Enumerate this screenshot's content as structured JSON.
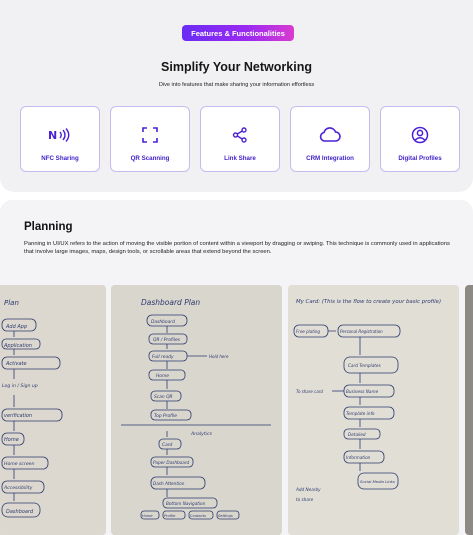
{
  "features": {
    "badge": "Features & Functionalities",
    "title": "Simplify Your Networking",
    "subtitle": "Dive into features that make sharing your information effortless",
    "accent_color": "#4b21d6",
    "cards": [
      {
        "label": "NFC Sharing",
        "icon": "nfc-icon"
      },
      {
        "label": "QR Scanning",
        "icon": "qr-scan-icon"
      },
      {
        "label": "Link Share",
        "icon": "share-icon"
      },
      {
        "label": "CRM Integration",
        "icon": "cloud-icon"
      },
      {
        "label": "Digital Profiles",
        "icon": "profile-icon"
      }
    ]
  },
  "planning": {
    "title": "Planning",
    "description": "Panning in UI/UX refers to the action of moving the visible portion of content within a viewport by dragging or swiping. This technique is commonly used in applications that involve large images, maps, design tools, or scrollable areas that extend beyond the screen.",
    "sketches": [
      {
        "name": "sketch-1",
        "lines": [
          "Plan",
          "Add App",
          "Application",
          "Activate",
          "Log in / Sign up",
          "verification",
          "Home",
          "Home screen",
          "Accessibility",
          "Dashboard"
        ]
      },
      {
        "name": "sketch-2",
        "heading": "Dashboard Plan",
        "lines": [
          "Dashboard",
          "QR / Profiles",
          "Full ready",
          "Hold here",
          "Home",
          "Scan QR",
          "Top Profile",
          "Analytics",
          "Card",
          "Paper Dashboard",
          "Dash Attention",
          "Bottom Navigation",
          "Home",
          "Profile",
          "Contacts",
          "Settings"
        ]
      },
      {
        "name": "sketch-3",
        "heading": "My Card: (This is the flow to create your basic profile)",
        "lines": [
          "Free plating",
          "Personal Registration",
          "Card Templates",
          "To share card",
          "Business Name",
          "Template info",
          "Detailed",
          "Information",
          "Social Media Links",
          "Add Nearby",
          "to share"
        ]
      }
    ]
  }
}
